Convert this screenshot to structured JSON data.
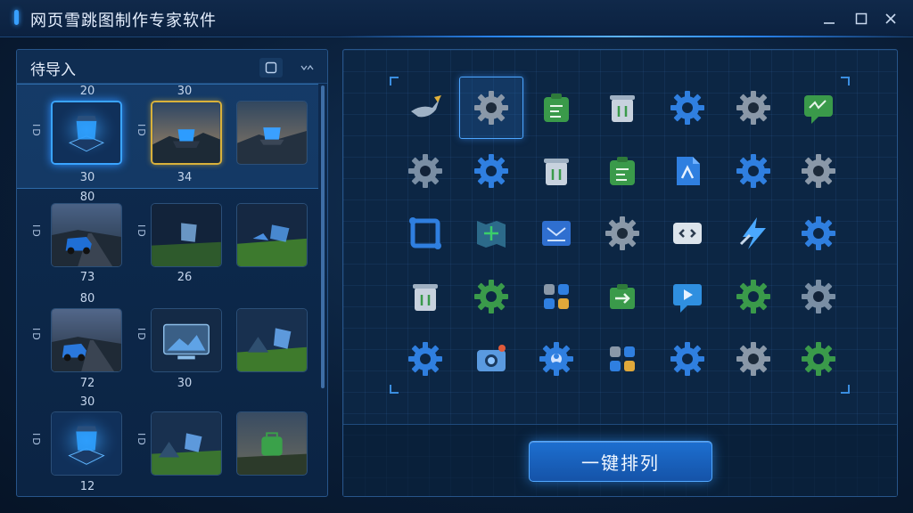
{
  "window": {
    "title": "网页雪跳图制作专家软件",
    "controls": [
      "minimize",
      "maximize",
      "close"
    ]
  },
  "left_panel": {
    "title": "待导入",
    "groups": [
      {
        "top_label": "20",
        "side_label_a": "ID",
        "side_label_b": "ID",
        "bottom_label_1": "30",
        "bottom_label_2": "34",
        "top_label_2": "30",
        "thumbs": [
          "cube-icon-thumb",
          "cube-landscape-thumb",
          "landscape-cube-thumb"
        ],
        "selected": true
      },
      {
        "top_label": "80",
        "side_label_a": "ID",
        "side_label_b": "ID",
        "bottom_label_1": "73",
        "bottom_label_2": "26",
        "thumbs": [
          "car-road-thumb",
          "glass-panel-thumb",
          "field-panel-thumb"
        ]
      },
      {
        "top_label": "80",
        "side_label_a": "ID",
        "side_label_b": "ID",
        "bottom_label_1": "72",
        "bottom_label_2": "30",
        "thumbs": [
          "car-road-thumb",
          "monitor-photo-thumb",
          "tent-field-thumb"
        ]
      },
      {
        "top_label": "30",
        "side_label_a": "ID",
        "side_label_b": "ID",
        "bottom_label_1": "12",
        "thumbs": [
          "cube-icon-thumb",
          "tent-field-thumb",
          "bag-field-thumb"
        ]
      }
    ]
  },
  "canvas": {
    "rows": [
      [
        "bird-icon",
        "gear-icon",
        "clipboard-icon",
        "trash-icon",
        "gear-icon",
        "gear-icon",
        "chat-icon"
      ],
      [
        "gear-icon",
        "gear-icon",
        "trash-icon",
        "clipboard-icon",
        "document-icon",
        "gear-icon",
        "gear-icon"
      ],
      [
        "link-icon",
        "map-icon",
        "mail-icon",
        "gear-icon",
        "code-icon",
        "lightning-icon",
        "gear-icon"
      ],
      [
        "trash-icon",
        "gear-icon",
        "apps-icon",
        "export-icon",
        "play-icon",
        "gear-icon",
        "gear-icon"
      ],
      [
        "gear-icon",
        "camera-icon",
        "user-gear-icon",
        "apps-icon",
        "gear-icon",
        "gear-icon",
        "gear-icon"
      ]
    ],
    "selected_cell": [
      0,
      1
    ]
  },
  "actions": {
    "arrange_label": "一键排列"
  },
  "colors": {
    "accent": "#2b8cff",
    "background": "#0a1e38",
    "panel": "#0e2b4f"
  }
}
